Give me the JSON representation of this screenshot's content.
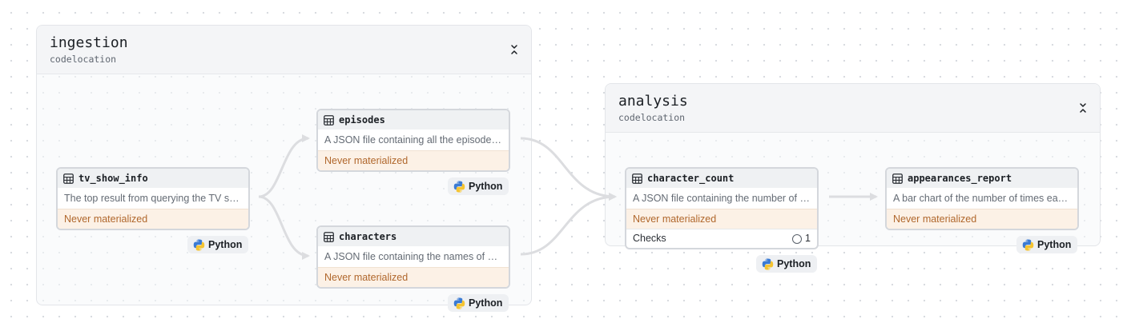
{
  "groups": [
    {
      "id": "ingestion",
      "title": "ingestion",
      "subtitle": "codelocation"
    },
    {
      "id": "analysis",
      "title": "analysis",
      "subtitle": "codelocation"
    }
  ],
  "assets": [
    {
      "id": "tv_show_info",
      "name": "tv_show_info",
      "description": "The top result from querying the TV show API",
      "status": "Never materialized",
      "kind": "Python"
    },
    {
      "id": "episodes",
      "name": "episodes",
      "description": "A JSON file containing all the episodes of the show",
      "status": "Never materialized",
      "kind": "Python"
    },
    {
      "id": "characters",
      "name": "characters",
      "description": "A JSON file containing the names of all characters",
      "status": "Never materialized",
      "kind": "Python"
    },
    {
      "id": "character_count",
      "name": "character_count",
      "description": "A JSON file containing the number of appearances per character",
      "status": "Never materialized",
      "checks_label": "Checks",
      "checks_count": "1",
      "kind": "Python"
    },
    {
      "id": "appearances_report",
      "name": "appearances_report",
      "description": "A bar chart of the number of times each character appears",
      "status": "Never materialized",
      "kind": "Python"
    }
  ],
  "colors": {
    "status_text": "#b0672c",
    "status_bg": "#fcf1e6",
    "edge": "#dcdde0",
    "python_blue": "#3b7bd4",
    "python_yellow": "#f5c431"
  }
}
